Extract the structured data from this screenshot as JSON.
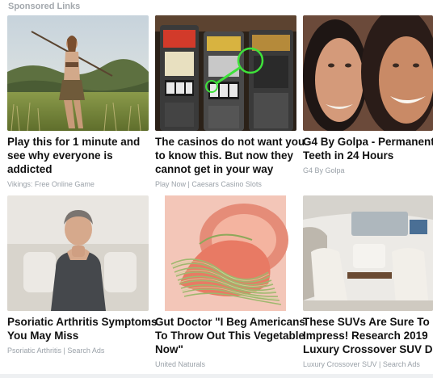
{
  "header": {
    "label": "Sponsored Links"
  },
  "cards": [
    {
      "title_lines": [
        "Play this for 1 minute and",
        "see why everyone is",
        "addicted"
      ],
      "source": "Vikings: Free Online Game"
    },
    {
      "title_lines": [
        "The casinos do not want you",
        "to know this. But now they",
        "cannot get in your way"
      ],
      "source": "Play Now | Caesars Casino Slots"
    },
    {
      "title_lines": [
        "G4 By Golpa - Permanent",
        "Teeth in 24 Hours"
      ],
      "source": "G4 By Golpa"
    },
    {
      "title_lines": [
        "Psoriatic Arthritis Symptoms",
        "You May Miss"
      ],
      "source": "Psoriatic Arthritis | Search Ads"
    },
    {
      "title_lines": [
        "Gut Doctor \"I Beg Americans",
        "To Throw Out This Vegetable",
        "Now\""
      ],
      "source": "United Naturals"
    },
    {
      "title_lines": [
        "These SUVs Are Sure To",
        "Impress! Research 2019",
        "Luxury Crossover SUV Deals"
      ],
      "source": "Luxury Crossover SUV | Search Ads"
    }
  ]
}
